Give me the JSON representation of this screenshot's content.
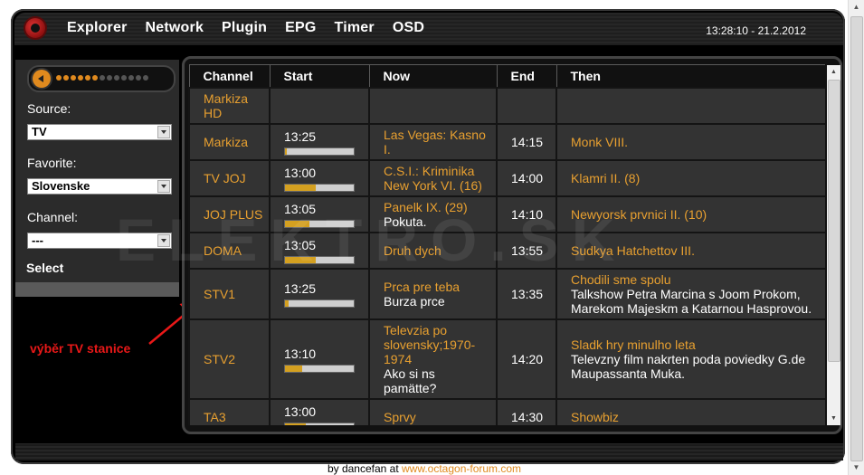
{
  "header": {
    "nav": [
      "Explorer",
      "Network",
      "Plugin",
      "EPG",
      "Timer",
      "OSD"
    ],
    "clock": "13:28:10 - 21.2.2012"
  },
  "left_panel": {
    "volume": {
      "level": 0.45,
      "dots_on": 6,
      "dots_total": 13
    },
    "source_label": "Source:",
    "source_value": "TV",
    "favorite_label": "Favorite:",
    "favorite_value": "Slovenske",
    "channel_label": "Channel:",
    "channel_value": "---",
    "select_label": "Select"
  },
  "annotation": "výběr TV stanice",
  "watermark": "ELEKTRO.SK",
  "table": {
    "headers": [
      "Channel",
      "Start",
      "Now",
      "End",
      "Then"
    ],
    "rows": [
      {
        "channel": "Markiza HD",
        "start": "",
        "now": "",
        "now_sub": "",
        "end": "",
        "then": "",
        "then_sub": "",
        "progress": null
      },
      {
        "channel": "Markiza",
        "start": "13:25",
        "now": "Las Vegas: Kasno I.",
        "now_sub": "",
        "end": "14:15",
        "then": "Monk VIII.",
        "then_sub": "",
        "progress": 0.02
      },
      {
        "channel": "TV JOJ",
        "start": "13:00",
        "now": "C.S.I.: Kriminika New York VI. (16)",
        "now_sub": "",
        "end": "14:00",
        "then": "Klamri II. (8)",
        "then_sub": "",
        "progress": 0.45
      },
      {
        "channel": "JOJ PLUS",
        "start": "13:05",
        "now": "Panelk IX. (29)",
        "now_sub": "Pokuta.",
        "end": "14:10",
        "then": "Newyorsk prvnici II. (10)",
        "then_sub": "",
        "progress": 0.35
      },
      {
        "channel": "DOMA",
        "start": "13:05",
        "now": "Druh dych",
        "now_sub": "",
        "end": "13:55",
        "then": "Sudkya Hatchettov III.",
        "then_sub": "",
        "progress": 0.45
      },
      {
        "channel": "STV1",
        "start": "13:25",
        "now": "Prca pre teba",
        "now_sub": "Burza prce",
        "end": "13:35",
        "then": "Chodili sme spolu",
        "then_sub": "Talkshow Petra Marcina s Joom Prokom, Marekom Majeskm a Katarnou Hasprovou.",
        "progress": 0.05
      },
      {
        "channel": "STV2",
        "start": "13:10",
        "now": "Televzia po slovensky;1970-1974",
        "now_sub": "Ako si ns pamätte?",
        "end": "14:20",
        "then": "Sladk hry minulho leta",
        "then_sub": "Televzny film nakrten poda poviedky G.de Maupassanta Muka.",
        "progress": 0.25
      },
      {
        "channel": "TA3",
        "start": "13:00",
        "now": "Sprvy",
        "now_sub": "",
        "end": "14:30",
        "then": "Showbiz",
        "then_sub": "",
        "progress": 0.3
      }
    ]
  },
  "footer": {
    "prefix": "by dancefan at ",
    "link": "www.octagon-forum.com"
  },
  "colors": {
    "accent": "#e8a030",
    "annotation": "#e81818",
    "cell_bg": "#333333"
  }
}
